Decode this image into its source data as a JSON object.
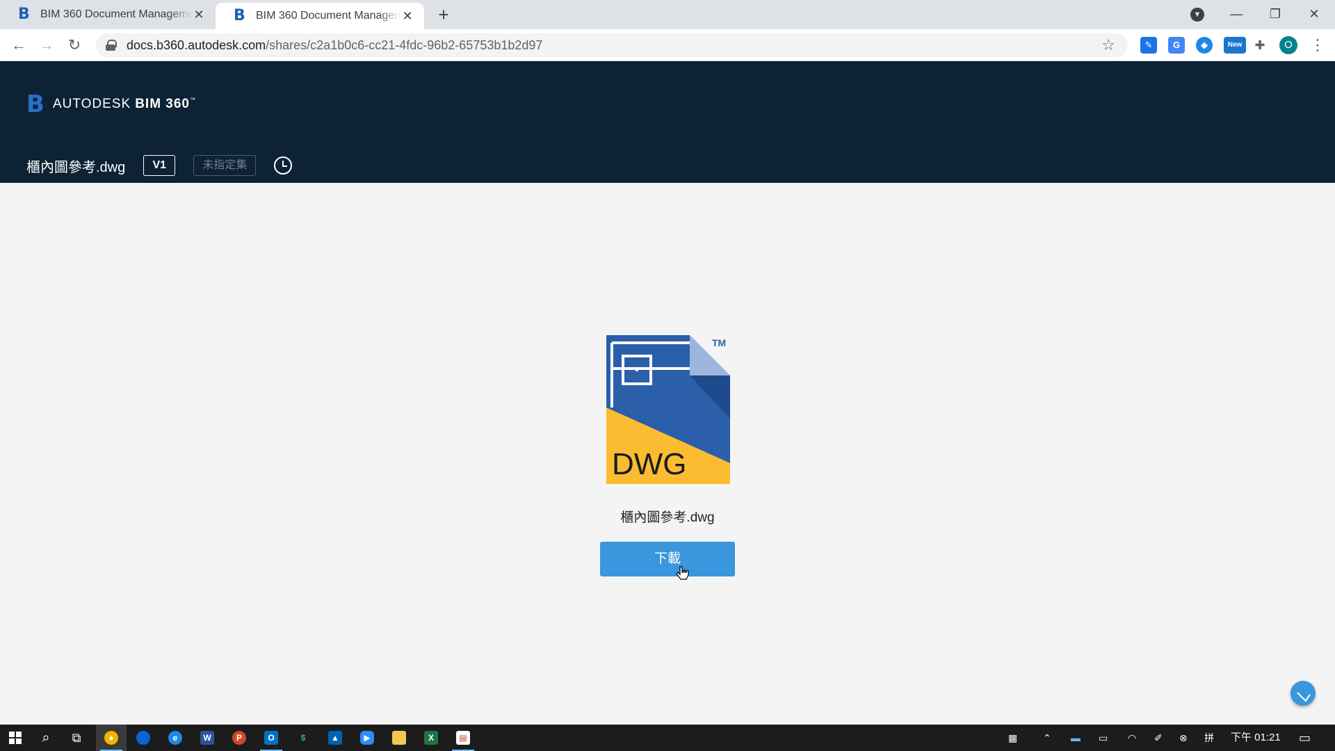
{
  "browser": {
    "tabs": [
      {
        "title": "BIM 360 Document Management",
        "active": false
      },
      {
        "title": "BIM 360 Document Management",
        "active": true
      }
    ],
    "url_host": "docs.b360.autodesk.com",
    "url_path": "/shares/c2a1b0c6-cc21-4fdc-96b2-65753b1b2d97",
    "new_badge": "New",
    "profile_initial": "O"
  },
  "header": {
    "brand_prefix": "AUTODESK",
    "brand_product": "BIM 360",
    "brand_tm": "™",
    "file_title": "櫃內圖參考.dwg",
    "version": "V1",
    "set_label": "未指定集"
  },
  "main": {
    "file_type_label": "DWG",
    "trademark": "TM",
    "file_name": "櫃內圖參考.dwg",
    "download_label": "下載"
  },
  "taskbar": {
    "clock": "下午 01:21"
  },
  "colors": {
    "header_bg": "#0e2235",
    "accent_blue": "#3a96dd",
    "dwg_blue": "#2b5faa",
    "dwg_yellow": "#fbbc32"
  }
}
